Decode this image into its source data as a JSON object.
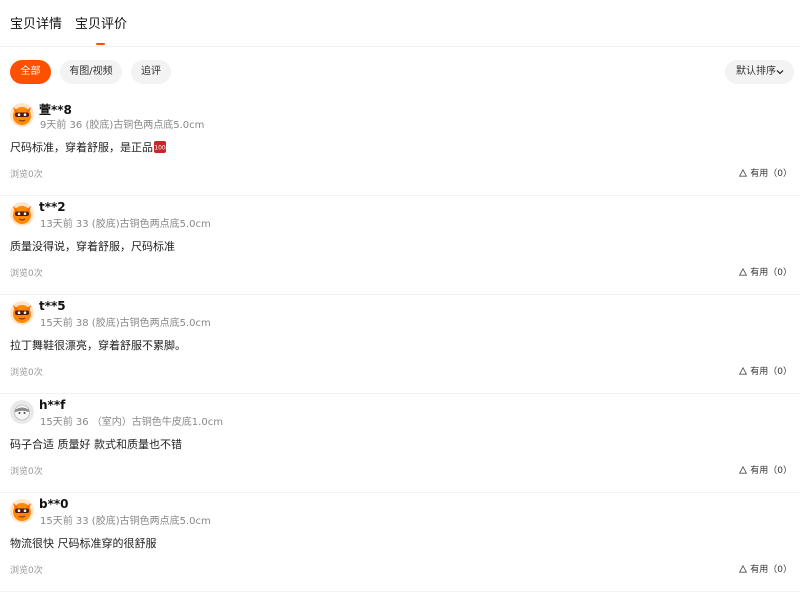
{
  "tabs": [
    {
      "label": "宝贝详情"
    },
    {
      "label": "宝贝评价"
    }
  ],
  "filters": [
    {
      "label": "全部"
    },
    {
      "label": "有图/视频"
    },
    {
      "label": "追评"
    }
  ],
  "sort": {
    "label": "默认排序"
  },
  "reviews": [
    {
      "nick": "萱**8",
      "meta": "9天前 36 (胶底)古铜色两点底5.0cm",
      "text": "尺码标准，穿着舒服，是正品",
      "views": "浏览0次",
      "useful": "有用（0）",
      "avatar": "orange-mask"
    },
    {
      "nick": "t**2",
      "meta": "13天前 33 (胶底)古铜色两点底5.0cm",
      "text": "质量没得说，穿着舒服，尺码标准",
      "views": "浏览0次",
      "useful": "有用（0）",
      "avatar": "orange-mask"
    },
    {
      "nick": "t**5",
      "meta": "15天前 38 (胶底)古铜色两点底5.0cm",
      "text": "拉丁舞鞋很漂亮，穿着舒服不累脚。",
      "views": "浏览0次",
      "useful": "有用（0）",
      "avatar": "orange-mask"
    },
    {
      "nick": "h**f",
      "meta": "15天前 36 （室内）古铜色牛皮底1.0cm",
      "text": "码子合适 质量好 款式和质量也不错",
      "views": "浏览0次",
      "useful": "有用（0）",
      "avatar": "grey-mask"
    },
    {
      "nick": "b**0",
      "meta": "15天前 33 (胶底)古铜色两点底5.0cm",
      "text": "物流很快 尺码标准穿的很舒服",
      "views": "浏览0次",
      "useful": "有用（0）",
      "avatar": "orange-mask"
    }
  ],
  "colors": {
    "accent": "#ff5000"
  }
}
